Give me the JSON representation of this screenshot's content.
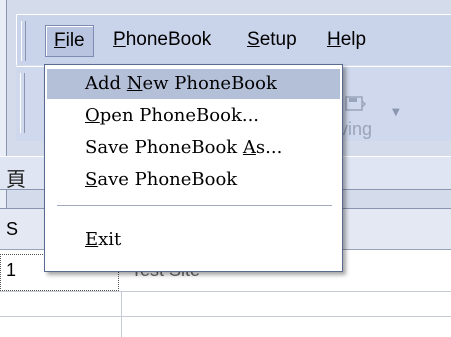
{
  "menubar": {
    "items": [
      {
        "label": "File",
        "mnemonic": "F"
      },
      {
        "label": "PhoneBook",
        "mnemonic": "P"
      },
      {
        "label": "Setup",
        "mnemonic": "S"
      },
      {
        "label": "Help",
        "mnemonic": "H"
      }
    ]
  },
  "toolbar": {
    "partial_label": "ving",
    "icon": "disk-icon"
  },
  "tabs": {
    "partial_char": "頁"
  },
  "table": {
    "header_partial": "S",
    "rows": [
      {
        "num": "1",
        "name": "Test Site"
      }
    ]
  },
  "file_menu": {
    "items": [
      {
        "label": "Add New PhoneBook",
        "mnemonic": "N"
      },
      {
        "label": "Open PhoneBook...",
        "mnemonic": "O"
      },
      {
        "label": "Save PhoneBook As...",
        "mnemonic": "A"
      },
      {
        "label": "Save PhoneBook",
        "mnemonic": "S"
      },
      {
        "label": "Exit",
        "mnemonic": "E"
      }
    ],
    "highlighted_index": 0
  },
  "colors": {
    "menu_highlight": "#b4bfd8",
    "menubar_bg": "#c9d3ea"
  }
}
